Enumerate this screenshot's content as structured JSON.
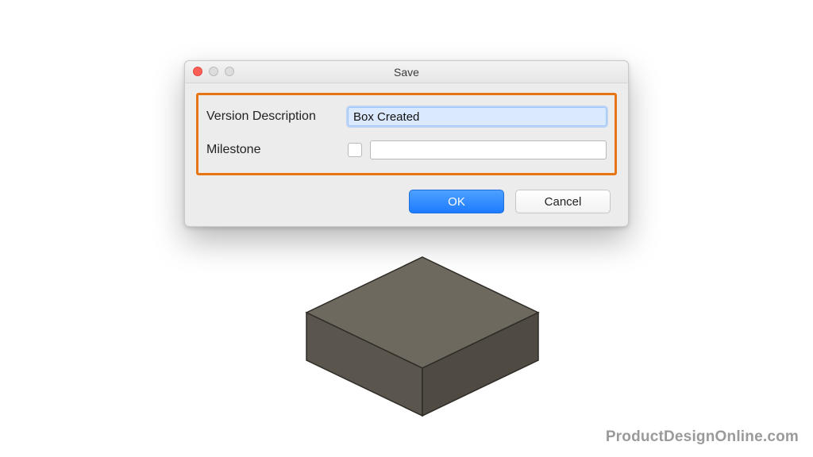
{
  "dialog": {
    "title": "Save",
    "version_description_label": "Version Description",
    "version_description_value": "Box Created",
    "milestone_label": "Milestone",
    "milestone_value": "",
    "ok_label": "OK",
    "cancel_label": "Cancel"
  },
  "watermark": "ProductDesignOnline.com",
  "colors": {
    "highlight_border": "#e77514",
    "primary_button": "#2b85ff"
  }
}
